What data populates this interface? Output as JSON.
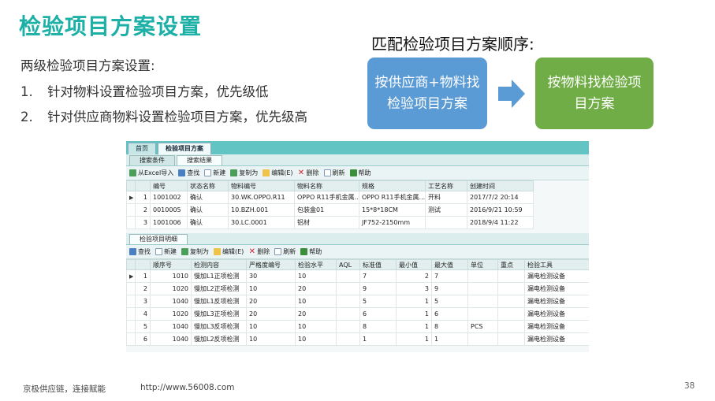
{
  "slide": {
    "title": "检验项目方案设置",
    "intro": "两级检验项目方案设置:",
    "items": [
      {
        "num": "1.",
        "text": "针对物料设置检验项目方案，优先级低"
      },
      {
        "num": "2.",
        "text": "针对供应商物料设置检验项目方案，优先级高"
      }
    ],
    "order_title": "匹配检验项目方案顺序:",
    "flow": {
      "step1": "按供应商+物料找检验项目方案",
      "step2": "按物料找检验项目方案",
      "colors": {
        "step1": "#5b9bd5",
        "step2": "#70ad47",
        "arrow": "#5b9bd5"
      }
    },
    "footer": {
      "tagline": "京极供应链，连接赋能",
      "url": "http://www.56008.com",
      "page": "38"
    },
    "title_color": "#1cb0a6"
  },
  "app": {
    "tabs": [
      "首页",
      "检验项目方案"
    ],
    "subtabs": [
      "搜索条件",
      "搜索结果"
    ],
    "toolbar": [
      {
        "label": "从Excel导入",
        "icon": "excel-import-icon"
      },
      {
        "label": "查找",
        "icon": "binoculars-icon"
      },
      {
        "label": "新建",
        "icon": "new-document-icon"
      },
      {
        "label": "复制为",
        "icon": "copy-icon"
      },
      {
        "label": "编辑(E)",
        "icon": "edit-icon"
      },
      {
        "label": "删除",
        "icon": "delete-x-icon"
      },
      {
        "label": "刷新",
        "icon": "refresh-icon"
      },
      {
        "label": "帮助",
        "icon": "help-icon"
      }
    ],
    "results": {
      "columns": [
        "编号",
        "状态名称",
        "物料编号",
        "物料名称",
        "规格",
        "工艺名称",
        "创建时间"
      ],
      "rows": [
        {
          "idx": "1",
          "code": "1001002",
          "status": "确认",
          "material_code": "30.WK.OPPO.R11",
          "material_name": "OPPO R11手机金属...",
          "spec": "OPPO R11手机金属...",
          "process": "开料",
          "created": "2017/7/2 20:14"
        },
        {
          "idx": "2",
          "code": "0010005",
          "status": "确认",
          "material_code": "10.BZH.001",
          "material_name": "包装盒01",
          "spec": "15*8*18CM",
          "process": "测试",
          "created": "2016/9/21 10:59"
        },
        {
          "idx": "3",
          "code": "1001006",
          "status": "确认",
          "material_code": "30.LC.0001",
          "material_name": "铝材",
          "spec": "JF752-2150mm",
          "process": "",
          "created": "2018/9/4 11:22"
        }
      ]
    },
    "detail": {
      "tab": "检验项目明细",
      "toolbar": [
        {
          "label": "查找",
          "icon": "binoculars-icon"
        },
        {
          "label": "新建",
          "icon": "new-document-icon"
        },
        {
          "label": "复制为",
          "icon": "copy-icon"
        },
        {
          "label": "编辑(E)",
          "icon": "edit-icon"
        },
        {
          "label": "删除",
          "icon": "delete-x-icon"
        },
        {
          "label": "刷新",
          "icon": "refresh-icon"
        },
        {
          "label": "帮助",
          "icon": "help-icon"
        }
      ],
      "columns": [
        "顺序号",
        "检测内容",
        "严格度编号",
        "检验水平",
        "AQL",
        "标准值",
        "最小值",
        "最大值",
        "单位",
        "重点",
        "检验工具"
      ],
      "rows": [
        {
          "idx": "1",
          "seq": "1010",
          "content": "慢加L1正项检测",
          "strict": "30",
          "level": "10",
          "aql": "",
          "std": "7",
          "min": "2",
          "max": "7",
          "unit": "",
          "key": "",
          "tool": "漏电检测设备"
        },
        {
          "idx": "2",
          "seq": "1020",
          "content": "慢加L2正项检测",
          "strict": "10",
          "level": "20",
          "aql": "",
          "std": "9",
          "min": "3",
          "max": "9",
          "unit": "",
          "key": "",
          "tool": "漏电检测设备"
        },
        {
          "idx": "3",
          "seq": "1040",
          "content": "慢加L1反项检测",
          "strict": "20",
          "level": "10",
          "aql": "",
          "std": "5",
          "min": "1",
          "max": "5",
          "unit": "",
          "key": "",
          "tool": "漏电检测设备"
        },
        {
          "idx": "4",
          "seq": "1020",
          "content": "慢加L3正项检测",
          "strict": "20",
          "level": "20",
          "aql": "",
          "std": "6",
          "min": "1",
          "max": "6",
          "unit": "",
          "key": "",
          "tool": "漏电检测设备"
        },
        {
          "idx": "5",
          "seq": "1040",
          "content": "慢加L3反项检测",
          "strict": "10",
          "level": "10",
          "aql": "",
          "std": "8",
          "min": "1",
          "max": "8",
          "unit": "PCS",
          "key": "",
          "tool": "漏电检测设备"
        },
        {
          "idx": "6",
          "seq": "1040",
          "content": "慢加L2反项检测",
          "strict": "10",
          "level": "10",
          "aql": "",
          "std": "1",
          "min": "1",
          "max": "1",
          "unit": "",
          "key": "",
          "tool": "漏电检测设备"
        }
      ]
    }
  }
}
